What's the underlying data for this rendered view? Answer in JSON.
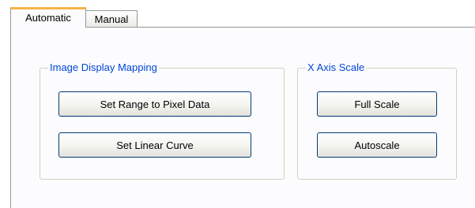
{
  "tabs": [
    {
      "label": "Automatic",
      "active": true
    },
    {
      "label": "Manual",
      "active": false
    }
  ],
  "groups": {
    "image_display_mapping": {
      "title": "Image Display Mapping",
      "buttons": [
        "Set Range to Pixel Data",
        "Set Linear Curve"
      ]
    },
    "x_axis_scale": {
      "title": "X Axis Scale",
      "buttons": [
        "Full Scale",
        "Autoscale"
      ]
    }
  },
  "colors": {
    "group_title": "#0046d5",
    "active_tab_accent": "#f7b24a",
    "button_border": "#003c74"
  }
}
